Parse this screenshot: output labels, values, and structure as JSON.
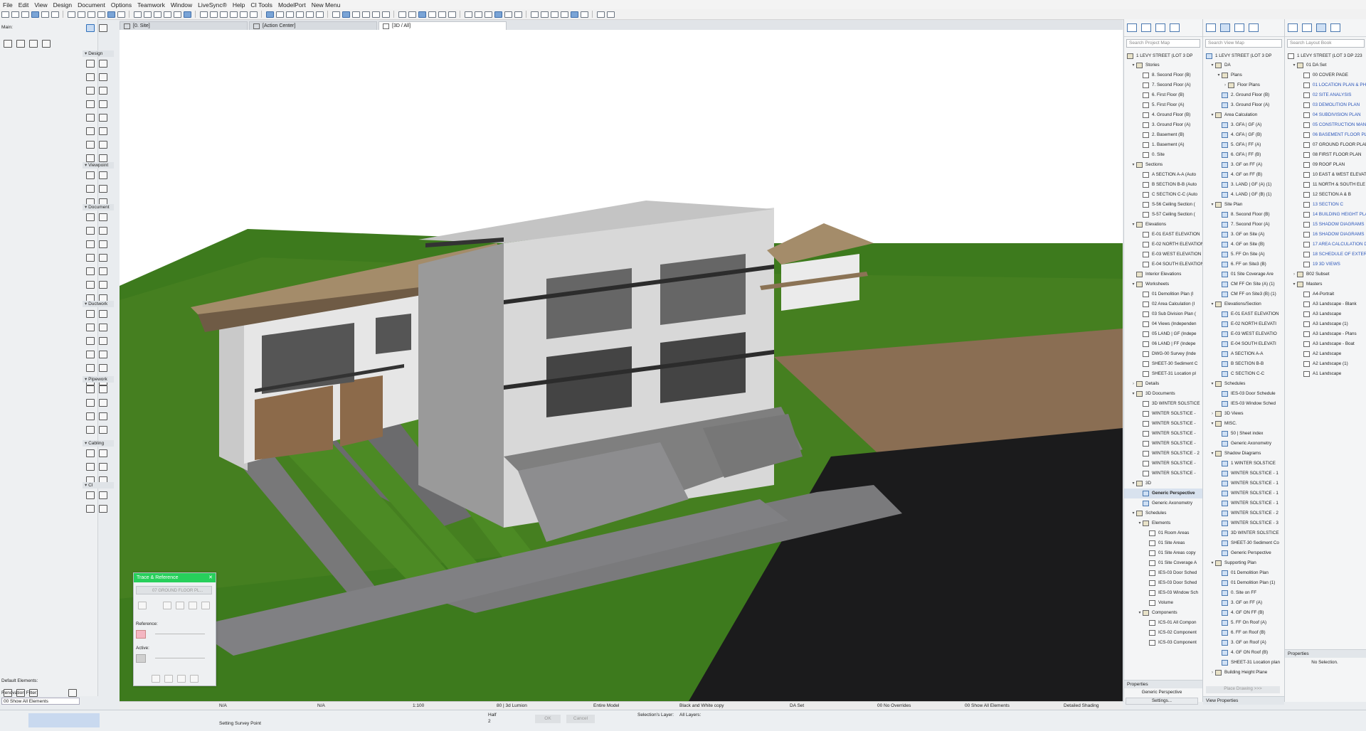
{
  "menu": [
    "File",
    "Edit",
    "View",
    "Design",
    "Document",
    "Options",
    "Teamwork",
    "Window",
    "LiveSync®",
    "Help",
    "CI Tools",
    "ModelPort",
    "New Menu"
  ],
  "toolbox": {
    "main_label": "Main:",
    "sections": [
      "Design",
      "Viewpoint",
      "Document",
      "Ductwork",
      "Pipework",
      "Cabling",
      "CI"
    ],
    "default_elements_label": "Default Elements:",
    "renovation_filter_label": "Renovation Filter:",
    "renovation_filter_value": "00 Show All Elements"
  },
  "tabs": [
    "[0. Site]",
    "[Action Center]",
    "[3D / All]"
  ],
  "trace": {
    "title": "Trace & Reference",
    "close": "✕",
    "source": "07 GROUND FLOOR PL...",
    "reference_label": "Reference:",
    "active_label": "Active:"
  },
  "project_map": {
    "search": "Search Project Map",
    "root": "1 LEVY STREET (LOT 3 DP",
    "items": [
      {
        "t": "Stories",
        "lvl": 1,
        "k": "fold",
        "tw": "▾"
      },
      {
        "t": "8. Second Floor (B)",
        "lvl": 2,
        "k": "doc"
      },
      {
        "t": "7. Second Floor (A)",
        "lvl": 2,
        "k": "doc"
      },
      {
        "t": "6. First Floor (B)",
        "lvl": 2,
        "k": "doc"
      },
      {
        "t": "5. First Floor (A)",
        "lvl": 2,
        "k": "doc"
      },
      {
        "t": "4. Ground Floor (B)",
        "lvl": 2,
        "k": "doc"
      },
      {
        "t": "3. Ground Floor (A)",
        "lvl": 2,
        "k": "doc"
      },
      {
        "t": "2. Basement (B)",
        "lvl": 2,
        "k": "doc"
      },
      {
        "t": "1. Basement (A)",
        "lvl": 2,
        "k": "doc"
      },
      {
        "t": "0. Site",
        "lvl": 2,
        "k": "doc"
      },
      {
        "t": "Sections",
        "lvl": 1,
        "k": "fold",
        "tw": "▾"
      },
      {
        "t": "A SECTION A-A (Auto",
        "lvl": 2,
        "k": "doc"
      },
      {
        "t": "B SECTION B-B (Auto",
        "lvl": 2,
        "k": "doc"
      },
      {
        "t": "C SECTION C-C (Auto",
        "lvl": 2,
        "k": "doc"
      },
      {
        "t": "S-56 Ceiling Section (",
        "lvl": 2,
        "k": "doc"
      },
      {
        "t": "S-57 Ceiling Section (",
        "lvl": 2,
        "k": "doc"
      },
      {
        "t": "Elevations",
        "lvl": 1,
        "k": "fold",
        "tw": "▾"
      },
      {
        "t": "E-01 EAST ELEVATION",
        "lvl": 2,
        "k": "doc"
      },
      {
        "t": "E-02 NORTH ELEVATION",
        "lvl": 2,
        "k": "doc"
      },
      {
        "t": "E-03 WEST ELEVATION",
        "lvl": 2,
        "k": "doc"
      },
      {
        "t": "E-04 SOUTH ELEVATION",
        "lvl": 2,
        "k": "doc"
      },
      {
        "t": "Interior Elevations",
        "lvl": 1,
        "k": "fold"
      },
      {
        "t": "Worksheets",
        "lvl": 1,
        "k": "fold",
        "tw": "▾"
      },
      {
        "t": "01 Demolition Plan (I",
        "lvl": 2,
        "k": "doc"
      },
      {
        "t": "02 Area Calculation (I",
        "lvl": 2,
        "k": "doc"
      },
      {
        "t": "03 Sub Division Plan (",
        "lvl": 2,
        "k": "doc"
      },
      {
        "t": "04 Views (Independen",
        "lvl": 2,
        "k": "doc"
      },
      {
        "t": "05 LAND | GF (Indepe",
        "lvl": 2,
        "k": "doc"
      },
      {
        "t": "06 LAND | FF (Indepe",
        "lvl": 2,
        "k": "doc"
      },
      {
        "t": "DWG-00 Survey (Inde",
        "lvl": 2,
        "k": "doc"
      },
      {
        "t": "SHEET-30 Sediment C",
        "lvl": 2,
        "k": "doc"
      },
      {
        "t": "SHEET-31 Location pl",
        "lvl": 2,
        "k": "doc"
      },
      {
        "t": "Details",
        "lvl": 1,
        "k": "fold",
        "tw": "›"
      },
      {
        "t": "3D Documents",
        "lvl": 1,
        "k": "fold",
        "tw": "▾"
      },
      {
        "t": "3D WINTER SOLSTICE",
        "lvl": 2,
        "k": "doc"
      },
      {
        "t": "WINTER SOLSTICE -",
        "lvl": 2,
        "k": "doc"
      },
      {
        "t": "WINTER SOLSTICE -",
        "lvl": 2,
        "k": "doc"
      },
      {
        "t": "WINTER SOLSTICE -",
        "lvl": 2,
        "k": "doc"
      },
      {
        "t": "WINTER SOLSTICE -",
        "lvl": 2,
        "k": "doc"
      },
      {
        "t": "WINTER SOLSTICE - 2",
        "lvl": 2,
        "k": "doc"
      },
      {
        "t": "WINTER SOLSTICE -",
        "lvl": 2,
        "k": "doc"
      },
      {
        "t": "WINTER SOLSTICE -",
        "lvl": 2,
        "k": "doc"
      },
      {
        "t": "3D",
        "lvl": 1,
        "k": "fold",
        "tw": "▾"
      },
      {
        "t": "Generic Perspective",
        "lvl": 2,
        "k": "cam",
        "sel": true
      },
      {
        "t": "Generic Axonometry",
        "lvl": 2,
        "k": "cam"
      },
      {
        "t": "Schedules",
        "lvl": 1,
        "k": "fold",
        "tw": "▾"
      },
      {
        "t": "Elements",
        "lvl": 2,
        "k": "fold",
        "tw": "▾"
      },
      {
        "t": "01 Room Areas",
        "lvl": 3,
        "k": "doc"
      },
      {
        "t": "01 Site Areas",
        "lvl": 3,
        "k": "doc"
      },
      {
        "t": "01 Site Areas copy",
        "lvl": 3,
        "k": "doc"
      },
      {
        "t": "01 Site Coverage A",
        "lvl": 3,
        "k": "doc"
      },
      {
        "t": "IES-03 Door Sched",
        "lvl": 3,
        "k": "doc"
      },
      {
        "t": "IES-03 Door Sched",
        "lvl": 3,
        "k": "doc"
      },
      {
        "t": "IES-03 Window Sch",
        "lvl": 3,
        "k": "doc"
      },
      {
        "t": "Volume",
        "lvl": 3,
        "k": "doc"
      },
      {
        "t": "Components",
        "lvl": 2,
        "k": "fold",
        "tw": "▾"
      },
      {
        "t": "ICS-01 All Compon",
        "lvl": 3,
        "k": "doc"
      },
      {
        "t": "ICS-02 Component",
        "lvl": 3,
        "k": "doc"
      },
      {
        "t": "ICS-03 Component",
        "lvl": 3,
        "k": "doc"
      }
    ],
    "properties_label": "Properties",
    "properties_value": "Generic Perspective",
    "settings_button": "Settings..."
  },
  "view_map": {
    "search": "Search View Map",
    "root": "1 LEVY STREET (LOT 3 DP",
    "items": [
      {
        "t": "DA",
        "lvl": 1,
        "k": "fold",
        "tw": "▾"
      },
      {
        "t": "Plans",
        "lvl": 2,
        "k": "fold",
        "tw": "▾"
      },
      {
        "t": "Floor Plans",
        "lvl": 3,
        "k": "fold",
        "tw": "›"
      },
      {
        "t": "2. Ground Floor (B)",
        "lvl": 2,
        "k": "cam"
      },
      {
        "t": "3. Ground Floor (A)",
        "lvl": 2,
        "k": "cam"
      },
      {
        "t": "Area Calculation",
        "lvl": 1,
        "k": "fold",
        "tw": "▾"
      },
      {
        "t": "3. GFA | GF (A)",
        "lvl": 2,
        "k": "cam"
      },
      {
        "t": "4. GFA | GF (B)",
        "lvl": 2,
        "k": "cam"
      },
      {
        "t": "5. GFA | FF (A)",
        "lvl": 2,
        "k": "cam"
      },
      {
        "t": "6. GFA | FF (B)",
        "lvl": 2,
        "k": "cam"
      },
      {
        "t": "3. GF on FF (A)",
        "lvl": 2,
        "k": "cam"
      },
      {
        "t": "4. GF on FF (B)",
        "lvl": 2,
        "k": "cam"
      },
      {
        "t": "3. LAND | GF (A) (1)",
        "lvl": 2,
        "k": "cam"
      },
      {
        "t": "4. LAND | GF (B) (1)",
        "lvl": 2,
        "k": "cam"
      },
      {
        "t": "Site Plan",
        "lvl": 1,
        "k": "fold",
        "tw": "▾"
      },
      {
        "t": "8. Second Floor (B)",
        "lvl": 2,
        "k": "cam"
      },
      {
        "t": "7. Second Floor (A)",
        "lvl": 2,
        "k": "cam"
      },
      {
        "t": "3. GF on Site (A)",
        "lvl": 2,
        "k": "cam"
      },
      {
        "t": "4. GF on Site (B)",
        "lvl": 2,
        "k": "cam"
      },
      {
        "t": "5. FF On Site (A)",
        "lvl": 2,
        "k": "cam"
      },
      {
        "t": "6. FF on Site3 (B)",
        "lvl": 2,
        "k": "cam"
      },
      {
        "t": "01 Site Coverage Are",
        "lvl": 2,
        "k": "cam"
      },
      {
        "t": "CM FF On Site (A) (1)",
        "lvl": 2,
        "k": "cam"
      },
      {
        "t": "CM FF on Site3 (B) (1)",
        "lvl": 2,
        "k": "cam"
      },
      {
        "t": "Elevations/Section",
        "lvl": 1,
        "k": "fold",
        "tw": "▾"
      },
      {
        "t": "E-01 EAST ELEVATION",
        "lvl": 2,
        "k": "cam"
      },
      {
        "t": "E-02 NORTH ELEVATI",
        "lvl": 2,
        "k": "cam"
      },
      {
        "t": "E-03 WEST ELEVATIO",
        "lvl": 2,
        "k": "cam"
      },
      {
        "t": "E-04 SOUTH ELEVATI",
        "lvl": 2,
        "k": "cam"
      },
      {
        "t": "A SECTION A-A",
        "lvl": 2,
        "k": "cam"
      },
      {
        "t": "B SECTION B-B",
        "lvl": 2,
        "k": "cam"
      },
      {
        "t": "C SECTION C-C",
        "lvl": 2,
        "k": "cam"
      },
      {
        "t": "Schedules",
        "lvl": 1,
        "k": "fold",
        "tw": "▾"
      },
      {
        "t": "IES-03 Door Schedule",
        "lvl": 2,
        "k": "cam"
      },
      {
        "t": "IES-03 Window Sched",
        "lvl": 2,
        "k": "cam"
      },
      {
        "t": "3D Views",
        "lvl": 1,
        "k": "fold",
        "tw": "›"
      },
      {
        "t": "MISC.",
        "lvl": 1,
        "k": "fold",
        "tw": "▾"
      },
      {
        "t": "50 | Sheet index",
        "lvl": 2,
        "k": "cam"
      },
      {
        "t": "Generic Axonometry",
        "lvl": 2,
        "k": "cam"
      },
      {
        "t": "Shadow Diagrams",
        "lvl": 1,
        "k": "fold",
        "tw": "▾"
      },
      {
        "t": "1 WINTER SOLSTICE",
        "lvl": 2,
        "k": "cam"
      },
      {
        "t": "WINTER SOLSTICE - 1",
        "lvl": 2,
        "k": "cam"
      },
      {
        "t": "WINTER SOLSTICE - 1",
        "lvl": 2,
        "k": "cam"
      },
      {
        "t": "WINTER SOLSTICE - 1",
        "lvl": 2,
        "k": "cam"
      },
      {
        "t": "WINTER SOLSTICE - 1",
        "lvl": 2,
        "k": "cam"
      },
      {
        "t": "WINTER SOLSTICE - 2",
        "lvl": 2,
        "k": "cam"
      },
      {
        "t": "WINTER SOLSTICE - 3",
        "lvl": 2,
        "k": "cam"
      },
      {
        "t": "3D WINTER SOLSTICE",
        "lvl": 2,
        "k": "cam"
      },
      {
        "t": "SHEET-30 Sediment Co",
        "lvl": 2,
        "k": "cam"
      },
      {
        "t": "Generic Perspective",
        "lvl": 2,
        "k": "cam"
      },
      {
        "t": "Supporting Plan",
        "lvl": 1,
        "k": "fold",
        "tw": "▾"
      },
      {
        "t": "01 Demolition Plan",
        "lvl": 2,
        "k": "cam"
      },
      {
        "t": "01 Demolition Plan (1)",
        "lvl": 2,
        "k": "cam"
      },
      {
        "t": "0. Site on FF",
        "lvl": 2,
        "k": "cam"
      },
      {
        "t": "3. GF on FF (A)",
        "lvl": 2,
        "k": "cam"
      },
      {
        "t": "4. GF ON FF (B)",
        "lvl": 2,
        "k": "cam"
      },
      {
        "t": "5. FF On Roof (A)",
        "lvl": 2,
        "k": "cam"
      },
      {
        "t": "6. FF on Roof (B)",
        "lvl": 2,
        "k": "cam"
      },
      {
        "t": "3. GF on Roof (A)",
        "lvl": 2,
        "k": "cam"
      },
      {
        "t": "4. GF ON Roof (B)",
        "lvl": 2,
        "k": "cam"
      },
      {
        "t": "SHEET-31 Location plan",
        "lvl": 2,
        "k": "cam"
      },
      {
        "t": "Building Height Plane",
        "lvl": 1,
        "k": "fold",
        "tw": "›"
      }
    ],
    "place_drawing": "Place Drawing >>>",
    "view_properties": "View Properties"
  },
  "layout_book": {
    "search": "Search Layout Book",
    "root": "1 LEVY STREET (LOT 3 DP 223",
    "items": [
      {
        "t": "01 DA Set",
        "lvl": 1,
        "k": "fold",
        "tw": "▾"
      },
      {
        "t": "00 COVER PAGE",
        "lvl": 2,
        "k": "doc"
      },
      {
        "t": "01 LOCATION PLAN & PH",
        "lvl": 2,
        "k": "doc",
        "link": true
      },
      {
        "t": "02 SITE ANALYSIS",
        "lvl": 2,
        "k": "doc",
        "link": true
      },
      {
        "t": "03 DEMOLITION PLAN",
        "lvl": 2,
        "k": "doc",
        "link": true
      },
      {
        "t": "04 SUBDIVISION PLAN",
        "lvl": 2,
        "k": "doc",
        "link": true
      },
      {
        "t": "05 CONSTRUCTION MAN",
        "lvl": 2,
        "k": "doc",
        "link": true
      },
      {
        "t": "06 BASEMENT FLOOR PL",
        "lvl": 2,
        "k": "doc",
        "link": true
      },
      {
        "t": "07 GROUND FLOOR PLAN",
        "lvl": 2,
        "k": "doc"
      },
      {
        "t": "08 FIRST FLOOR PLAN",
        "lvl": 2,
        "k": "doc"
      },
      {
        "t": "09 ROOF PLAN",
        "lvl": 2,
        "k": "doc"
      },
      {
        "t": "10 EAST & WEST ELEVAT",
        "lvl": 2,
        "k": "doc"
      },
      {
        "t": "11 NORTH & SOUTH ELE",
        "lvl": 2,
        "k": "doc"
      },
      {
        "t": "12 SECTION A & B",
        "lvl": 2,
        "k": "doc"
      },
      {
        "t": "13 SECTION C",
        "lvl": 2,
        "k": "doc",
        "link": true
      },
      {
        "t": "14 BUILDING HEIGHT PLA",
        "lvl": 2,
        "k": "doc",
        "link": true
      },
      {
        "t": "15 SHADOW DIAGRAMS",
        "lvl": 2,
        "k": "doc",
        "link": true
      },
      {
        "t": "16 SHADOW DIAGRAMS",
        "lvl": 2,
        "k": "doc",
        "link": true
      },
      {
        "t": "17 AREA CALCULATION D",
        "lvl": 2,
        "k": "doc",
        "link": true
      },
      {
        "t": "18 SCHEDULE OF EXTERN",
        "lvl": 2,
        "k": "doc",
        "link": true
      },
      {
        "t": "19 3D VIEWS",
        "lvl": 2,
        "k": "doc",
        "link": true
      },
      {
        "t": "B02 Subset",
        "lvl": 1,
        "k": "fold",
        "tw": "›"
      },
      {
        "t": "Masters",
        "lvl": 1,
        "k": "fold",
        "tw": "▾"
      },
      {
        "t": "A4-Portrait",
        "lvl": 2,
        "k": "doc"
      },
      {
        "t": "A3 Landscape - Blank",
        "lvl": 2,
        "k": "doc"
      },
      {
        "t": "A3 Landscape",
        "lvl": 2,
        "k": "doc"
      },
      {
        "t": "A3 Landscape (1)",
        "lvl": 2,
        "k": "doc"
      },
      {
        "t": "A3 Landscape - Plans",
        "lvl": 2,
        "k": "doc"
      },
      {
        "t": "A3 Landscape - Boat",
        "lvl": 2,
        "k": "doc"
      },
      {
        "t": "A2 Landscape",
        "lvl": 2,
        "k": "doc"
      },
      {
        "t": "A2 Landscape (1)",
        "lvl": 2,
        "k": "doc"
      },
      {
        "t": "A1 Landscape",
        "lvl": 2,
        "k": "doc"
      }
    ],
    "properties_label": "Properties",
    "no_selection": "No Selection."
  },
  "status1": {
    "na1": "N/A",
    "na2": "N/A",
    "scale": "1:100",
    "view": "80 | 3d Lumion",
    "model": "Entire Model",
    "pen": "Black and White copy",
    "set": "DA Set",
    "overrides": "00 No Overrides",
    "show": "00 Show All Elements",
    "shading": "Detailed Shading"
  },
  "status2": {
    "setting_survey_point": "Setting Survey Point",
    "half": "Half",
    "two": "2",
    "ok": "OK",
    "cancel": "Cancel",
    "selections_layer": "Selection's Layer:",
    "all_layers": "All Layers:"
  }
}
